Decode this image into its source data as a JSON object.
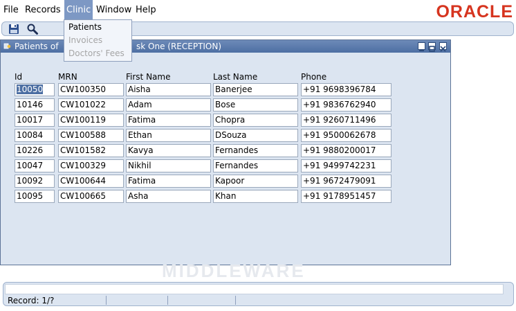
{
  "menubar": {
    "items": [
      "File",
      "Records",
      "Clinic",
      "Window",
      "Help"
    ],
    "logo": "ORACLE"
  },
  "clinic_menu": {
    "items": [
      {
        "label": "Patients",
        "enabled": true
      },
      {
        "label": "Invoices",
        "enabled": false
      },
      {
        "label": "Doctors' Fees",
        "enabled": false
      }
    ]
  },
  "toolbar": {
    "buttons": [
      {
        "icon": "floppy-disk-save-icon"
      },
      {
        "icon": "magnifier-search-icon"
      }
    ]
  },
  "window": {
    "title_left": "Patients of",
    "title_right": "sk One (RECEPTION)",
    "controls": [
      "minimize-icon",
      "maximize-icon",
      "close-icon"
    ]
  },
  "table": {
    "columns": [
      "Id",
      "MRN",
      "First Name",
      "Last Name",
      "Phone"
    ],
    "rows": [
      [
        "10050",
        "CW100350",
        "Aisha",
        "Banerjee",
        "+91 9698396784"
      ],
      [
        "10146",
        "CW101022",
        "Adam",
        "Bose",
        "+91 9836762940"
      ],
      [
        "10017",
        "CW100119",
        "Fatima",
        "Chopra",
        "+91 9260711496"
      ],
      [
        "10084",
        "CW100588",
        "Ethan",
        "DSouza",
        "+91 9500062678"
      ],
      [
        "10226",
        "CW101582",
        "Kavya",
        "Fernandes",
        "+91 9880200017"
      ],
      [
        "10047",
        "CW100329",
        "Nikhil",
        "Fernandes",
        "+91 9499742231"
      ],
      [
        "10092",
        "CW100644",
        "Fatima",
        "Kapoor",
        "+91 9672479091"
      ],
      [
        "10095",
        "CW100665",
        "Asha",
        "Khan",
        "+91 9178951457"
      ]
    ]
  },
  "watermark": "MIDDLEWARE",
  "statusbar": {
    "record": "Record: 1/?"
  },
  "colors": {
    "accent": "#4d6fa3",
    "oracle_red": "#d6341f",
    "panel_bg": "#dce5f1"
  }
}
